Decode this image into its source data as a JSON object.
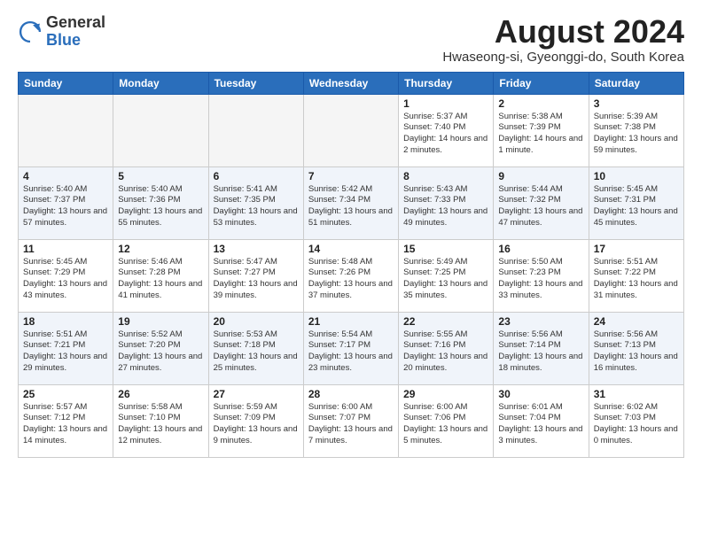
{
  "header": {
    "logo_general": "General",
    "logo_blue": "Blue",
    "month_title": "August 2024",
    "location": "Hwaseong-si, Gyeonggi-do, South Korea"
  },
  "weekdays": [
    "Sunday",
    "Monday",
    "Tuesday",
    "Wednesday",
    "Thursday",
    "Friday",
    "Saturday"
  ],
  "weeks": [
    [
      {
        "day": "",
        "empty": true
      },
      {
        "day": "",
        "empty": true
      },
      {
        "day": "",
        "empty": true
      },
      {
        "day": "",
        "empty": true
      },
      {
        "day": "1",
        "sunrise": "5:37 AM",
        "sunset": "7:40 PM",
        "daylight": "14 hours and 2 minutes."
      },
      {
        "day": "2",
        "sunrise": "5:38 AM",
        "sunset": "7:39 PM",
        "daylight": "14 hours and 1 minute."
      },
      {
        "day": "3",
        "sunrise": "5:39 AM",
        "sunset": "7:38 PM",
        "daylight": "13 hours and 59 minutes."
      }
    ],
    [
      {
        "day": "4",
        "sunrise": "5:40 AM",
        "sunset": "7:37 PM",
        "daylight": "13 hours and 57 minutes."
      },
      {
        "day": "5",
        "sunrise": "5:40 AM",
        "sunset": "7:36 PM",
        "daylight": "13 hours and 55 minutes."
      },
      {
        "day": "6",
        "sunrise": "5:41 AM",
        "sunset": "7:35 PM",
        "daylight": "13 hours and 53 minutes."
      },
      {
        "day": "7",
        "sunrise": "5:42 AM",
        "sunset": "7:34 PM",
        "daylight": "13 hours and 51 minutes."
      },
      {
        "day": "8",
        "sunrise": "5:43 AM",
        "sunset": "7:33 PM",
        "daylight": "13 hours and 49 minutes."
      },
      {
        "day": "9",
        "sunrise": "5:44 AM",
        "sunset": "7:32 PM",
        "daylight": "13 hours and 47 minutes."
      },
      {
        "day": "10",
        "sunrise": "5:45 AM",
        "sunset": "7:31 PM",
        "daylight": "13 hours and 45 minutes."
      }
    ],
    [
      {
        "day": "11",
        "sunrise": "5:45 AM",
        "sunset": "7:29 PM",
        "daylight": "13 hours and 43 minutes."
      },
      {
        "day": "12",
        "sunrise": "5:46 AM",
        "sunset": "7:28 PM",
        "daylight": "13 hours and 41 minutes."
      },
      {
        "day": "13",
        "sunrise": "5:47 AM",
        "sunset": "7:27 PM",
        "daylight": "13 hours and 39 minutes."
      },
      {
        "day": "14",
        "sunrise": "5:48 AM",
        "sunset": "7:26 PM",
        "daylight": "13 hours and 37 minutes."
      },
      {
        "day": "15",
        "sunrise": "5:49 AM",
        "sunset": "7:25 PM",
        "daylight": "13 hours and 35 minutes."
      },
      {
        "day": "16",
        "sunrise": "5:50 AM",
        "sunset": "7:23 PM",
        "daylight": "13 hours and 33 minutes."
      },
      {
        "day": "17",
        "sunrise": "5:51 AM",
        "sunset": "7:22 PM",
        "daylight": "13 hours and 31 minutes."
      }
    ],
    [
      {
        "day": "18",
        "sunrise": "5:51 AM",
        "sunset": "7:21 PM",
        "daylight": "13 hours and 29 minutes."
      },
      {
        "day": "19",
        "sunrise": "5:52 AM",
        "sunset": "7:20 PM",
        "daylight": "13 hours and 27 minutes."
      },
      {
        "day": "20",
        "sunrise": "5:53 AM",
        "sunset": "7:18 PM",
        "daylight": "13 hours and 25 minutes."
      },
      {
        "day": "21",
        "sunrise": "5:54 AM",
        "sunset": "7:17 PM",
        "daylight": "13 hours and 23 minutes."
      },
      {
        "day": "22",
        "sunrise": "5:55 AM",
        "sunset": "7:16 PM",
        "daylight": "13 hours and 20 minutes."
      },
      {
        "day": "23",
        "sunrise": "5:56 AM",
        "sunset": "7:14 PM",
        "daylight": "13 hours and 18 minutes."
      },
      {
        "day": "24",
        "sunrise": "5:56 AM",
        "sunset": "7:13 PM",
        "daylight": "13 hours and 16 minutes."
      }
    ],
    [
      {
        "day": "25",
        "sunrise": "5:57 AM",
        "sunset": "7:12 PM",
        "daylight": "13 hours and 14 minutes."
      },
      {
        "day": "26",
        "sunrise": "5:58 AM",
        "sunset": "7:10 PM",
        "daylight": "13 hours and 12 minutes."
      },
      {
        "day": "27",
        "sunrise": "5:59 AM",
        "sunset": "7:09 PM",
        "daylight": "13 hours and 9 minutes."
      },
      {
        "day": "28",
        "sunrise": "6:00 AM",
        "sunset": "7:07 PM",
        "daylight": "13 hours and 7 minutes."
      },
      {
        "day": "29",
        "sunrise": "6:00 AM",
        "sunset": "7:06 PM",
        "daylight": "13 hours and 5 minutes."
      },
      {
        "day": "30",
        "sunrise": "6:01 AM",
        "sunset": "7:04 PM",
        "daylight": "13 hours and 3 minutes."
      },
      {
        "day": "31",
        "sunrise": "6:02 AM",
        "sunset": "7:03 PM",
        "daylight": "13 hours and 0 minutes."
      }
    ]
  ]
}
